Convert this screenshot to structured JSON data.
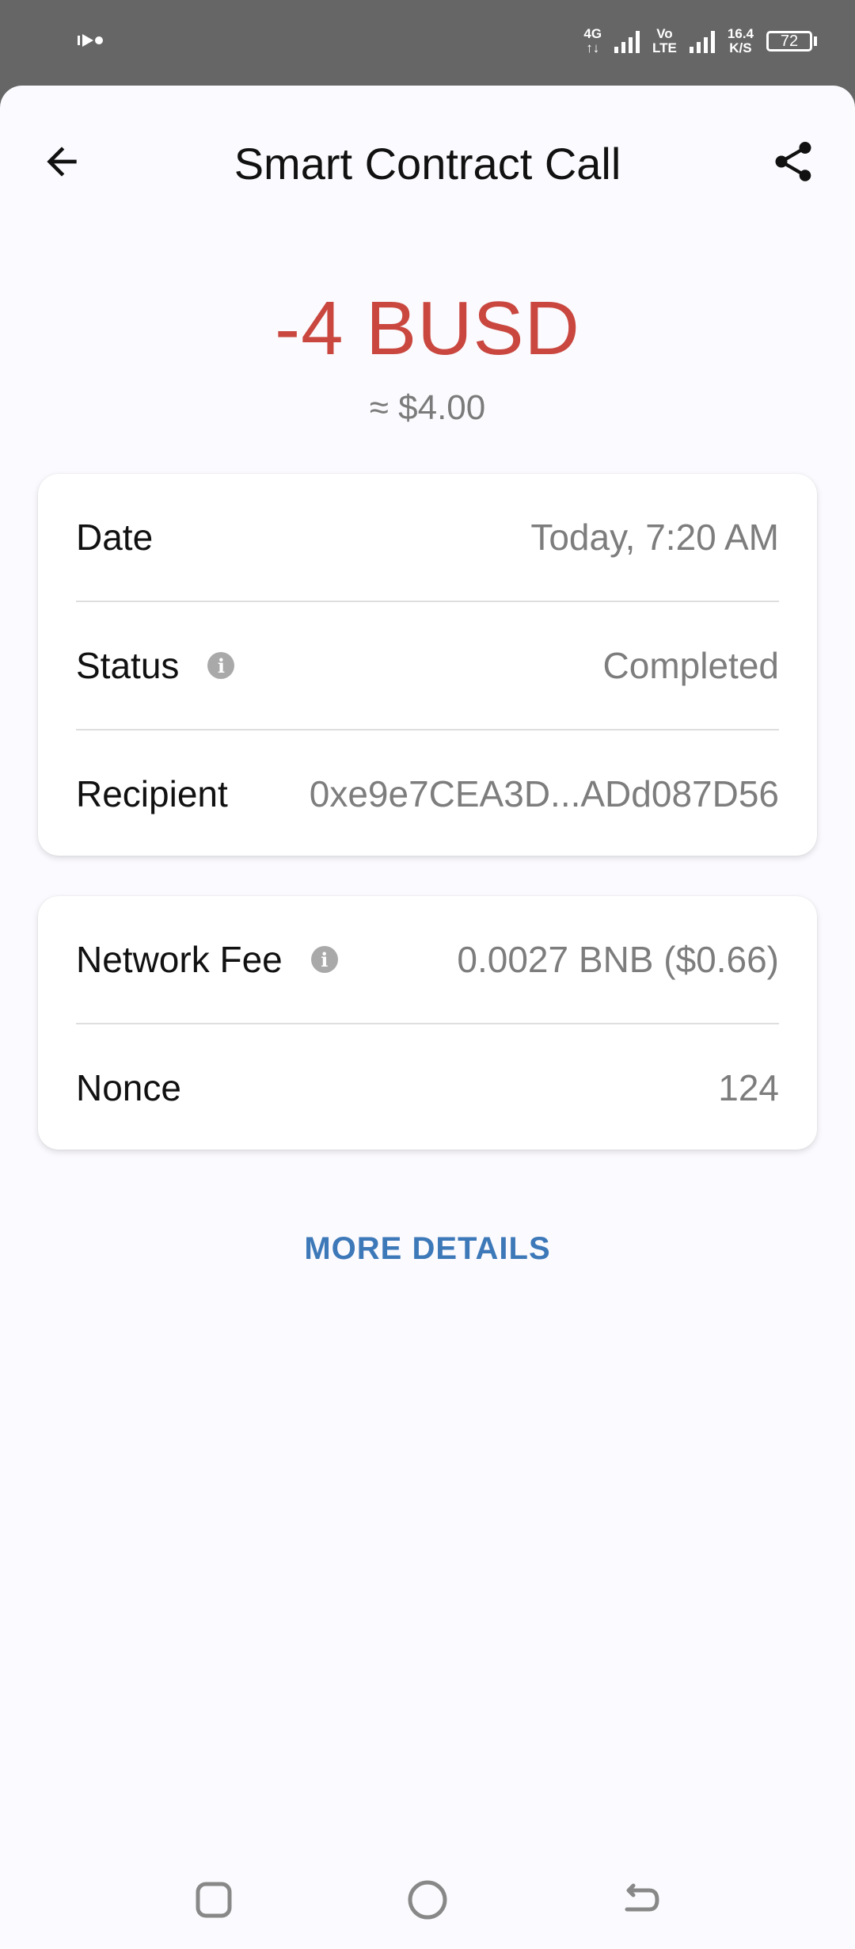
{
  "status_bar": {
    "left_icon": "media-icon",
    "net1_top": "4G",
    "net1_bottom": "↑↓",
    "net2_top": "Vo",
    "net2_bottom": "LTE",
    "speed_value": "16.4",
    "speed_unit": "K/S",
    "battery": "72"
  },
  "header": {
    "title": "Smart Contract Call",
    "back_icon": "arrow-left-icon",
    "share_icon": "share-icon"
  },
  "amount": {
    "value": "-4 BUSD",
    "fiat": "≈ $4.00",
    "color": "#c9473f"
  },
  "details": {
    "date_label": "Date",
    "date_value": "Today, 7:20 AM",
    "status_label": "Status",
    "status_value": "Completed",
    "recipient_label": "Recipient",
    "recipient_value": "0xe9e7CEA3D...ADd087D56"
  },
  "fees": {
    "fee_label": "Network Fee",
    "fee_value": "0.0027 BNB ($0.66)",
    "nonce_label": "Nonce",
    "nonce_value": "124"
  },
  "more_details": "MORE DETAILS",
  "accent_color": "#3d78b8"
}
